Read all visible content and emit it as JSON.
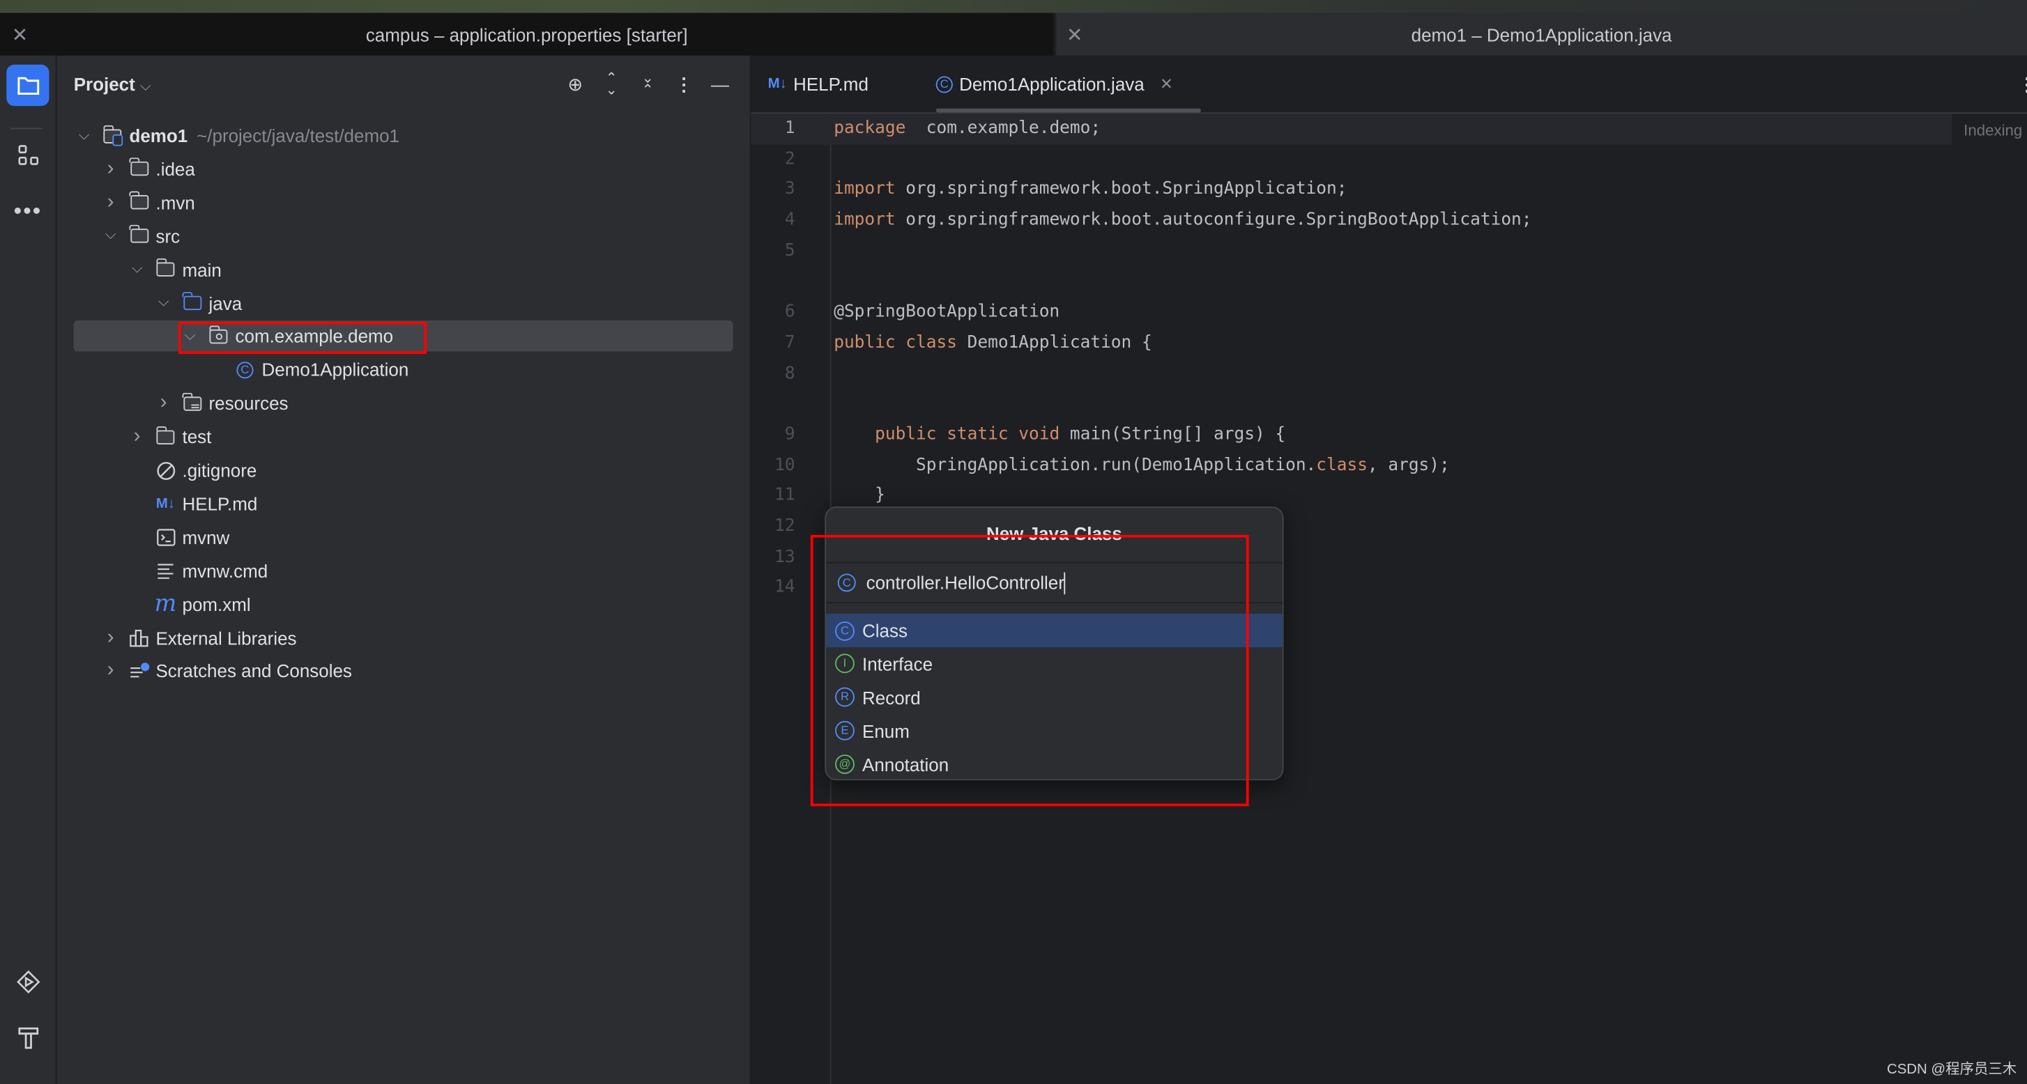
{
  "window_tabs": [
    {
      "title": "campus – application.properties [starter]",
      "active": false
    },
    {
      "title": "demo1 – Demo1Application.java",
      "active": true
    }
  ],
  "left_toolbar": {
    "top": [
      "folder-icon",
      "structure-icon",
      "more-icon"
    ],
    "bottom": [
      "run-icon",
      "build-hammer-icon"
    ]
  },
  "project_panel": {
    "title": "Project",
    "actions": [
      "locate-icon",
      "expand-all-icon",
      "collapse-all-icon",
      "options-icon",
      "hide-icon"
    ],
    "tree": [
      {
        "level": 0,
        "chevron": "open",
        "icon": "module",
        "label": "demo1",
        "hint": "~/project/java/test/demo1",
        "bold": true
      },
      {
        "level": 1,
        "chevron": "closed",
        "icon": "folder",
        "label": ".idea"
      },
      {
        "level": 1,
        "chevron": "closed",
        "icon": "folder",
        "label": ".mvn"
      },
      {
        "level": 1,
        "chevron": "open",
        "icon": "folder",
        "label": "src"
      },
      {
        "level": 2,
        "chevron": "open",
        "icon": "folder",
        "label": "main"
      },
      {
        "level": 3,
        "chevron": "open",
        "icon": "source-folder",
        "label": "java"
      },
      {
        "level": 4,
        "chevron": "open",
        "icon": "package",
        "label": "com.example.demo",
        "selected": true
      },
      {
        "level": 5,
        "chevron": "none",
        "icon": "spring-class",
        "label": "Demo1Application"
      },
      {
        "level": 3,
        "chevron": "closed",
        "icon": "resources-folder",
        "label": "resources"
      },
      {
        "level": 2,
        "chevron": "closed",
        "icon": "folder",
        "label": "test"
      },
      {
        "level": 2,
        "chevron": "none",
        "icon": "gitignore",
        "label": ".gitignore"
      },
      {
        "level": 2,
        "chevron": "none",
        "icon": "markdown",
        "label": "HELP.md"
      },
      {
        "level": 2,
        "chevron": "none",
        "icon": "shell",
        "label": "mvnw"
      },
      {
        "level": 2,
        "chevron": "none",
        "icon": "text",
        "label": "mvnw.cmd"
      },
      {
        "level": 2,
        "chevron": "none",
        "icon": "maven",
        "label": "pom.xml"
      },
      {
        "level": 1,
        "chevron": "closed",
        "icon": "libraries",
        "label": "External Libraries"
      },
      {
        "level": 1,
        "chevron": "closed",
        "icon": "scratches",
        "label": "Scratches and Consoles"
      }
    ]
  },
  "editor": {
    "tabs": [
      {
        "label": "HELP.md",
        "icon": "markdown",
        "active": false
      },
      {
        "label": "Demo1Application.java",
        "icon": "spring-class",
        "active": true
      }
    ],
    "status": "Indexing",
    "lines": [
      {
        "n": "1",
        "tokens": [
          [
            "kw",
            "package"
          ],
          [
            "",
            "  com.example.demo;"
          ]
        ]
      },
      {
        "n": "2",
        "tokens": []
      },
      {
        "n": "3",
        "tokens": [
          [
            "kw",
            "import"
          ],
          [
            "",
            " org.springframework.boot.SpringApplication;"
          ]
        ]
      },
      {
        "n": "4",
        "tokens": [
          [
            "kw",
            "import"
          ],
          [
            "",
            " org.springframework.boot.autoconfigure.SpringBootApplication;"
          ]
        ]
      },
      {
        "n": "5",
        "tokens": []
      },
      {
        "n": "6",
        "tokens": [
          [
            "",
            "@SpringBootApplication"
          ]
        ]
      },
      {
        "n": "7",
        "tokens": [
          [
            "kw",
            "public class"
          ],
          [
            "",
            " Demo1Application {"
          ]
        ]
      },
      {
        "n": "8",
        "tokens": []
      },
      {
        "n": "9",
        "tokens": [
          [
            "",
            "    "
          ],
          [
            "kw",
            "public static void"
          ],
          [
            "",
            " main(String[] args) {"
          ]
        ]
      },
      {
        "n": "10",
        "tokens": [
          [
            "",
            "        SpringApplication.run(Demo1Application."
          ],
          [
            "kw",
            "class"
          ],
          [
            "",
            ", args);"
          ]
        ]
      },
      {
        "n": "11",
        "tokens": [
          [
            "",
            "    }"
          ]
        ]
      },
      {
        "n": "12",
        "tokens": []
      },
      {
        "n": "13",
        "tokens": []
      },
      {
        "n": "14",
        "tokens": []
      }
    ]
  },
  "dialog": {
    "title": "New Java Class",
    "input_value": "controller.HelloController",
    "options": [
      {
        "label": "Class",
        "letter": "C",
        "color": "#548af7",
        "selected": true
      },
      {
        "label": "Interface",
        "letter": "I",
        "color": "#5fb865"
      },
      {
        "label": "Record",
        "letter": "R",
        "color": "#548af7"
      },
      {
        "label": "Enum",
        "letter": "E",
        "color": "#548af7"
      },
      {
        "label": "Annotation",
        "letter": "@",
        "color": "#5fb865"
      }
    ]
  },
  "annotation_color": "#ff0000",
  "watermark": "CSDN @程序员三木"
}
